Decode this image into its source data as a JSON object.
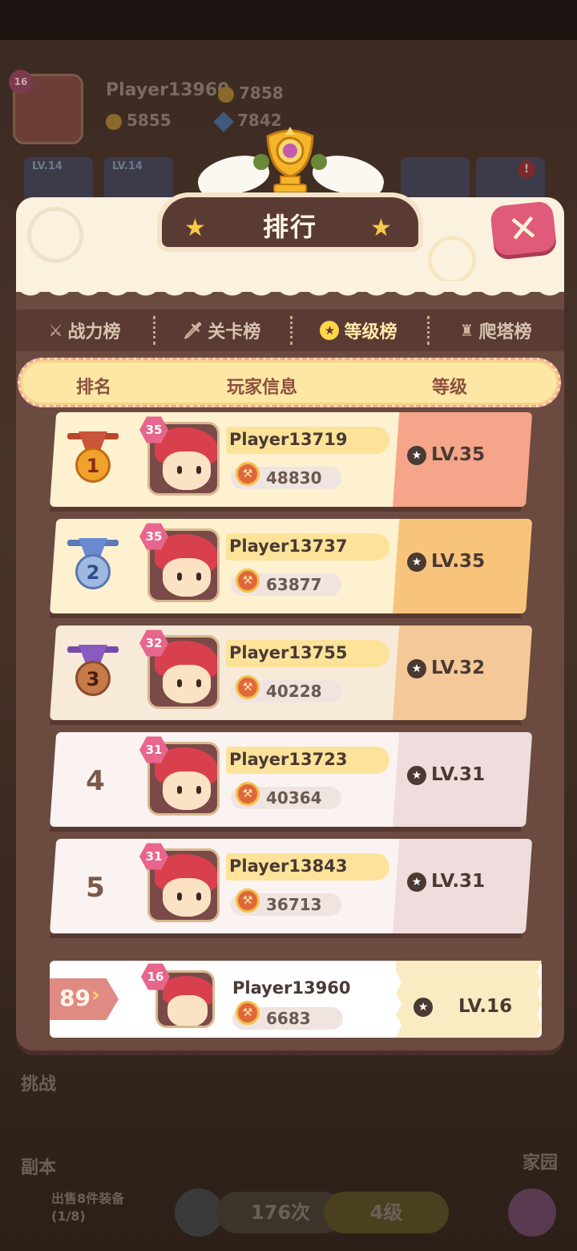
{
  "background": {
    "player_name": "Player13960",
    "player_level": "16",
    "power": "7858",
    "coins": "5855",
    "gems": "7842",
    "slot_levels": [
      "LV.14",
      "LV.14"
    ],
    "side_buttons": {
      "challenge": "挑战",
      "dungeon": "副本",
      "home": "家园"
    },
    "sell_text": "出售8件装备",
    "sell_count": "(1/8)",
    "times": "176次",
    "level_pill": "4级"
  },
  "modal": {
    "title": "排行",
    "close_icon": "close-icon",
    "tabs": [
      {
        "label": "战力榜",
        "icon": "sword-icon"
      },
      {
        "label": "关卡榜",
        "icon": "dagger-icon"
      },
      {
        "label": "等级榜",
        "icon": "star-icon",
        "active": true
      },
      {
        "label": "爬塔榜",
        "icon": "tower-icon"
      }
    ],
    "columns": {
      "rank": "排名",
      "info": "玩家信息",
      "level": "等级"
    },
    "rows": [
      {
        "rank": "1",
        "badge": "35",
        "name": "Player13719",
        "power": "48830",
        "level": "LV.35"
      },
      {
        "rank": "2",
        "badge": "35",
        "name": "Player13737",
        "power": "63877",
        "level": "LV.35"
      },
      {
        "rank": "3",
        "badge": "32",
        "name": "Player13755",
        "power": "40228",
        "level": "LV.32"
      },
      {
        "rank": "4",
        "badge": "31",
        "name": "Player13723",
        "power": "40364",
        "level": "LV.31"
      },
      {
        "rank": "5",
        "badge": "31",
        "name": "Player13843",
        "power": "36713",
        "level": "LV.31"
      }
    ],
    "mine": {
      "rank": "89",
      "badge": "16",
      "name": "Player13960",
      "power": "6683",
      "level": "LV.16"
    }
  },
  "colors": {
    "gold_row": "#fdf1cf",
    "gold_level": "#f5a58a",
    "silver_row": "#fdf1cf",
    "silver_level": "#f8c47c",
    "bronze_row": "#f7ead9",
    "bronze_level": "#f4c898",
    "plain_row": "#fbf3f1",
    "plain_level": "#efdcdc"
  }
}
